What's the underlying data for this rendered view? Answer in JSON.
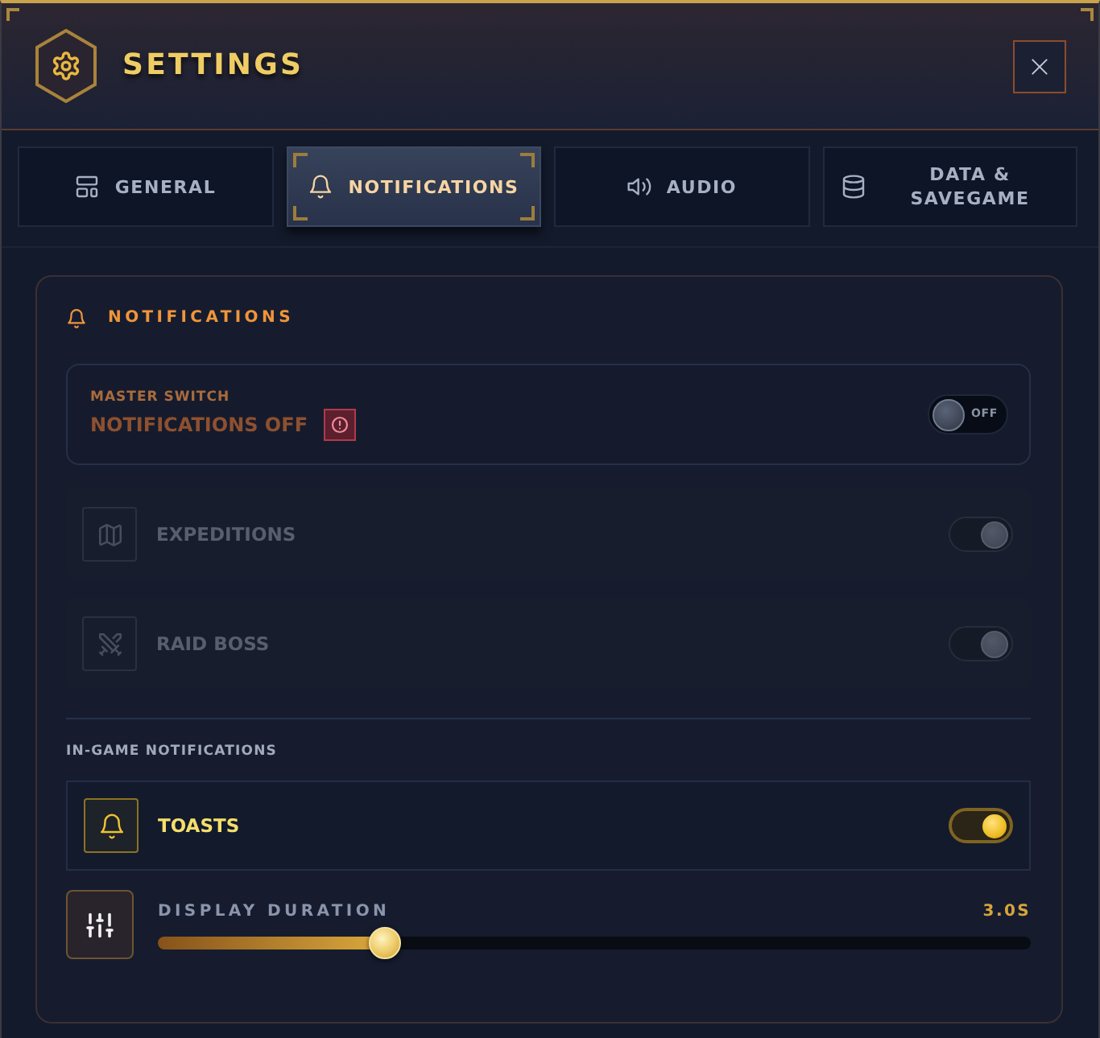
{
  "window": {
    "title": "SETTINGS"
  },
  "tabs": [
    {
      "label": "GENERAL",
      "selected": false
    },
    {
      "label": "NOTIFICATIONS",
      "selected": true
    },
    {
      "label": "AUDIO",
      "selected": false
    },
    {
      "label": "DATA & SAVEGAME",
      "selected": false
    }
  ],
  "notifications": {
    "title": "NOTIFICATIONS",
    "master": {
      "caption": "MASTER SWITCH",
      "status": "NOTIFICATIONS OFF",
      "on": false,
      "switch_label": "OFF"
    },
    "types": [
      {
        "label": "EXPEDITIONS",
        "on": true,
        "disabled": true
      },
      {
        "label": "RAID BOSS",
        "on": true,
        "disabled": true
      }
    ],
    "in_game": {
      "title": "IN-GAME NOTIFICATIONS",
      "toasts": {
        "label": "TOASTS",
        "on": true,
        "disabled": false
      },
      "display_duration": {
        "label": "DISPLAY DURATION",
        "reading": "3.0S",
        "level": 0.26
      }
    }
  }
}
